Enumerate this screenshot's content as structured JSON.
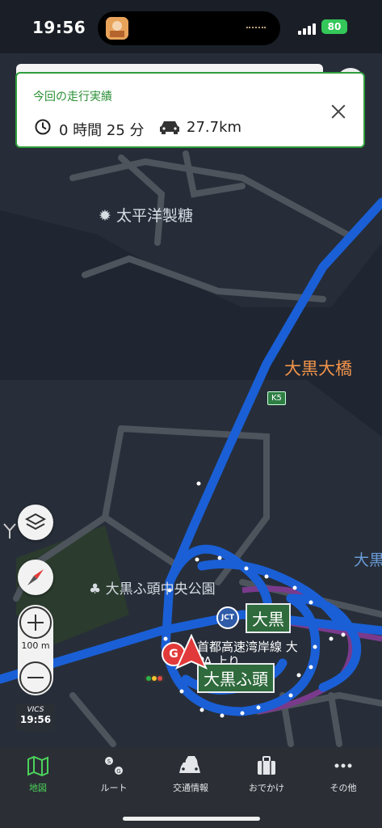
{
  "status_bar": {
    "time": "19:56",
    "battery": "80"
  },
  "banner": {
    "title": "今回の走行実績",
    "duration": "0 時間 25 分",
    "distance": "27.7km"
  },
  "map": {
    "labels": {
      "taiheiyo": "太平洋製糖",
      "bridge": "大黒大橋",
      "park": "大黒ふ頭中央公園",
      "edge": "大黒"
    },
    "route_shield": "K5",
    "jct_badge": "JCT",
    "sign_jct": "大黒",
    "sign_futo": "大黒ふ頭",
    "pa_line1": "首都高速湾岸線 大",
    "pa_line2": "PA 上り",
    "pa_badge": "G",
    "scale": "100 m",
    "vics_label": "VICS",
    "vics_time": "19:56"
  },
  "tabs": [
    {
      "label": "地図",
      "icon": "map-icon",
      "active": true
    },
    {
      "label": "ルート",
      "icon": "route-icon",
      "active": false
    },
    {
      "label": "交通情報",
      "icon": "traffic-icon",
      "active": false
    },
    {
      "label": "おでかけ",
      "icon": "suitcase-icon",
      "active": false
    },
    {
      "label": "その他",
      "icon": "more-icon",
      "active": false
    }
  ],
  "colors": {
    "route": "#1a5fd6",
    "accent": "#4bd35a",
    "banner_border": "#2f9d3a",
    "expressway": "#7a3a8c"
  }
}
